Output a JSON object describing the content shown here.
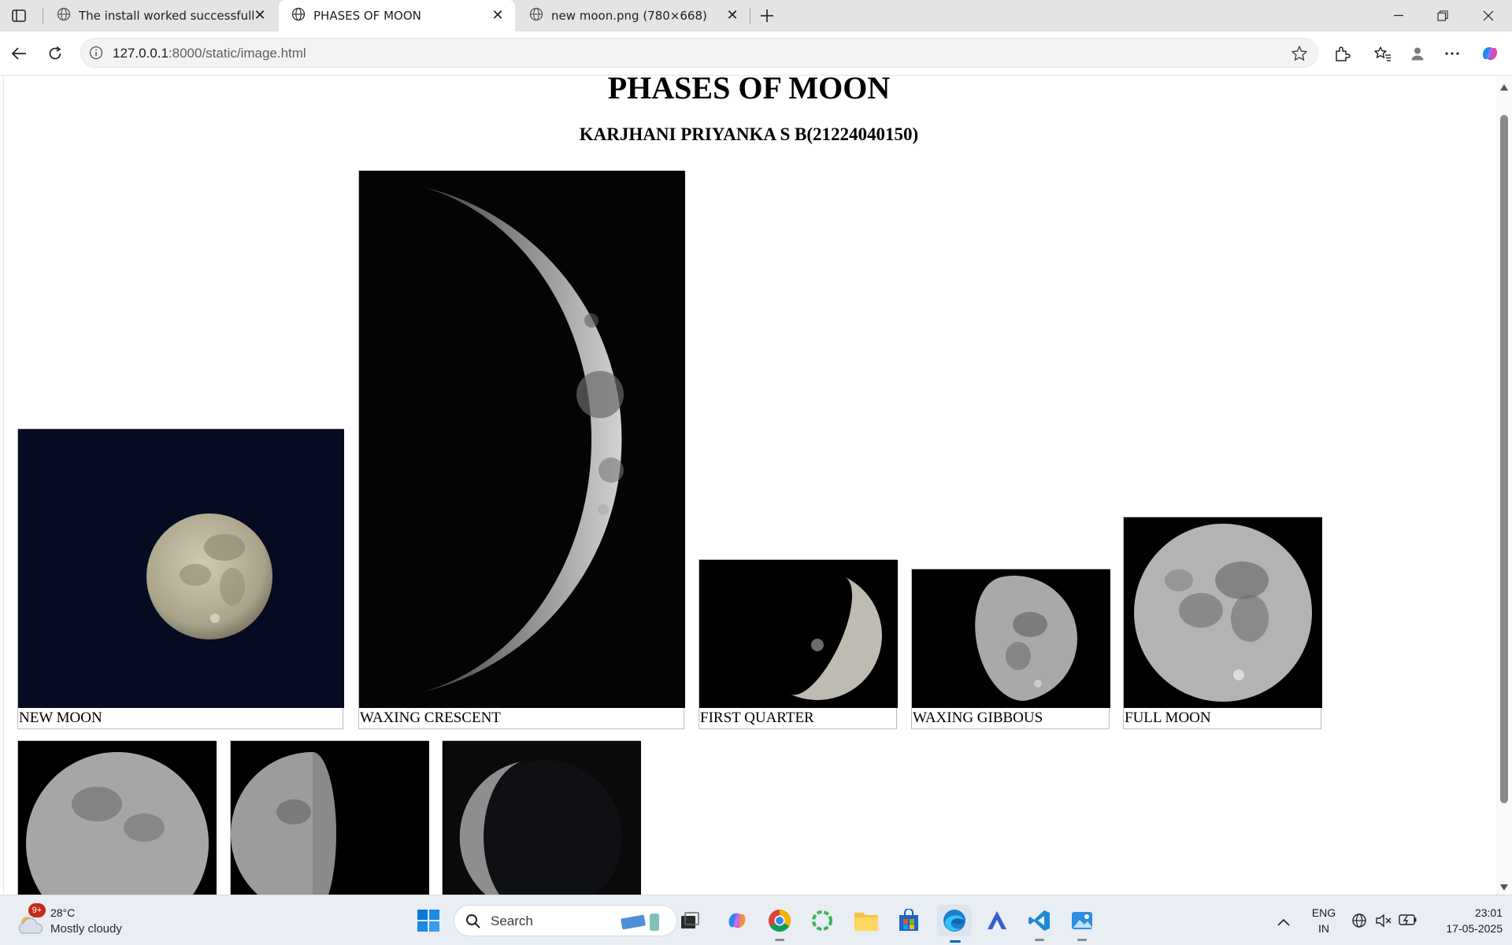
{
  "browser": {
    "tabs": [
      {
        "title": "The install worked successfully! Co",
        "active": false
      },
      {
        "title": "PHASES OF MOON",
        "active": true
      },
      {
        "title": "new moon.png (780×668)",
        "active": false
      }
    ],
    "url_host": "127.0.0.1",
    "url_path": ":8000/static/image.html"
  },
  "page": {
    "title": "PHASES OF MOON",
    "subtitle": "KARJHANI PRIYANKA S B(21224040150)",
    "figures": [
      {
        "caption": "NEW MOON",
        "sky": "#060b22",
        "illumination": 1.0
      },
      {
        "caption": "WAXING CRESCENT",
        "sky": "#040404",
        "illumination": 0.2
      },
      {
        "caption": "FIRST QUARTER",
        "sky": "#000000",
        "illumination": 0.5
      },
      {
        "caption": "WAXING GIBBOUS",
        "sky": "#000000",
        "illumination": 0.8
      },
      {
        "caption": "FULL MOON",
        "sky": "#000000",
        "illumination": 1.0
      },
      {
        "caption": "",
        "sky": "#000000",
        "illumination": 1.0
      },
      {
        "caption": "",
        "sky": "#000000",
        "illumination": 0.5
      },
      {
        "caption": "",
        "sky": "#0a0a0a",
        "illumination": 0.3
      }
    ]
  },
  "taskbar": {
    "weather_badge": "9+",
    "temperature": "28°C",
    "condition": "Mostly cloudy",
    "search_label": "Search",
    "language": "ENG",
    "region": "IN",
    "time": "23:01",
    "date": "17-05-2025"
  },
  "colors": {
    "accent": "#0067c0",
    "tab_bar": "#e4e4e4",
    "taskbar": "#e9edf4"
  }
}
